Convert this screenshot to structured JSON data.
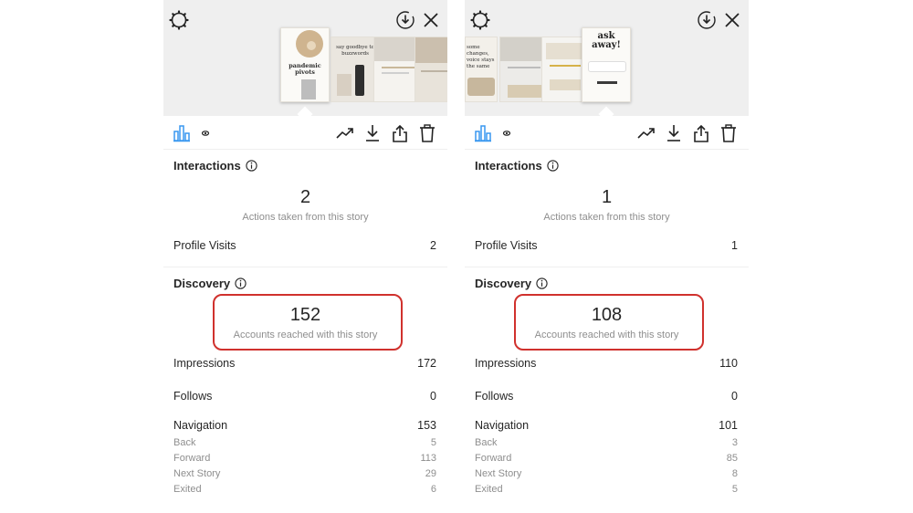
{
  "colors": {
    "accent_blue": "#3897f0",
    "highlight_red": "#d0312d",
    "muted_text": "#8e8e8e",
    "preview_bg": "#efefef"
  },
  "icons": [
    "settings-gear-icon",
    "download-circle-icon",
    "close-icon",
    "bar-chart-icon",
    "eye-icon",
    "trend-icon",
    "download-icon",
    "share-icon",
    "trash-icon",
    "info-icon"
  ],
  "left": {
    "previews": [
      {
        "text": "pandemic pivots"
      },
      {
        "text": "say goodbye to buzzwords"
      },
      {
        "text": ""
      },
      {
        "text": ""
      }
    ],
    "interactions": {
      "title": "Interactions",
      "count": "2",
      "count_label": "Actions taken from this story",
      "profile_visits_label": "Profile Visits",
      "profile_visits_value": "2"
    },
    "discovery": {
      "title": "Discovery",
      "reached": "152",
      "reached_label": "Accounts reached with this story",
      "impressions_label": "Impressions",
      "impressions_value": "172",
      "follows_label": "Follows",
      "follows_value": "0",
      "navigation_label": "Navigation",
      "navigation_value": "153",
      "back_label": "Back",
      "back_value": "5",
      "forward_label": "Forward",
      "forward_value": "113",
      "next_story_label": "Next Story",
      "next_story_value": "29",
      "exited_label": "Exited",
      "exited_value": "6"
    }
  },
  "right": {
    "previews": [
      {
        "text": "some changes, voice stays the same"
      },
      {
        "text": ""
      },
      {
        "text": ""
      },
      {
        "text": "ask away!"
      }
    ],
    "interactions": {
      "title": "Interactions",
      "count": "1",
      "count_label": "Actions taken from this story",
      "profile_visits_label": "Profile Visits",
      "profile_visits_value": "1"
    },
    "discovery": {
      "title": "Discovery",
      "reached": "108",
      "reached_label": "Accounts reached with this story",
      "impressions_label": "Impressions",
      "impressions_value": "110",
      "follows_label": "Follows",
      "follows_value": "0",
      "navigation_label": "Navigation",
      "navigation_value": "101",
      "back_label": "Back",
      "back_value": "3",
      "forward_label": "Forward",
      "forward_value": "85",
      "next_story_label": "Next Story",
      "next_story_value": "8",
      "exited_label": "Exited",
      "exited_value": "5"
    }
  }
}
